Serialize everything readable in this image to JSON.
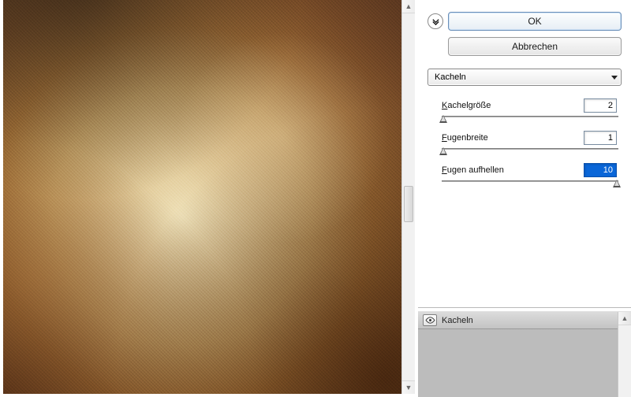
{
  "buttons": {
    "ok": "OK",
    "cancel": "Abbrechen"
  },
  "filter_dropdown": {
    "selected": "Kacheln"
  },
  "params": {
    "tile_size": {
      "label_u": "K",
      "label_rest": "achelgröße",
      "value": "2",
      "handle_pct": 1
    },
    "grout_width": {
      "label_u": "F",
      "label_rest": "ugenbreite",
      "value": "1",
      "handle_pct": 1
    },
    "lighten": {
      "label_u": "F",
      "label_rest": "ugen aufhellen",
      "value": "10",
      "handle_pct": 99,
      "selected": true
    }
  },
  "fx_list": {
    "items": [
      {
        "name": "Kacheln",
        "visible": true
      }
    ]
  }
}
